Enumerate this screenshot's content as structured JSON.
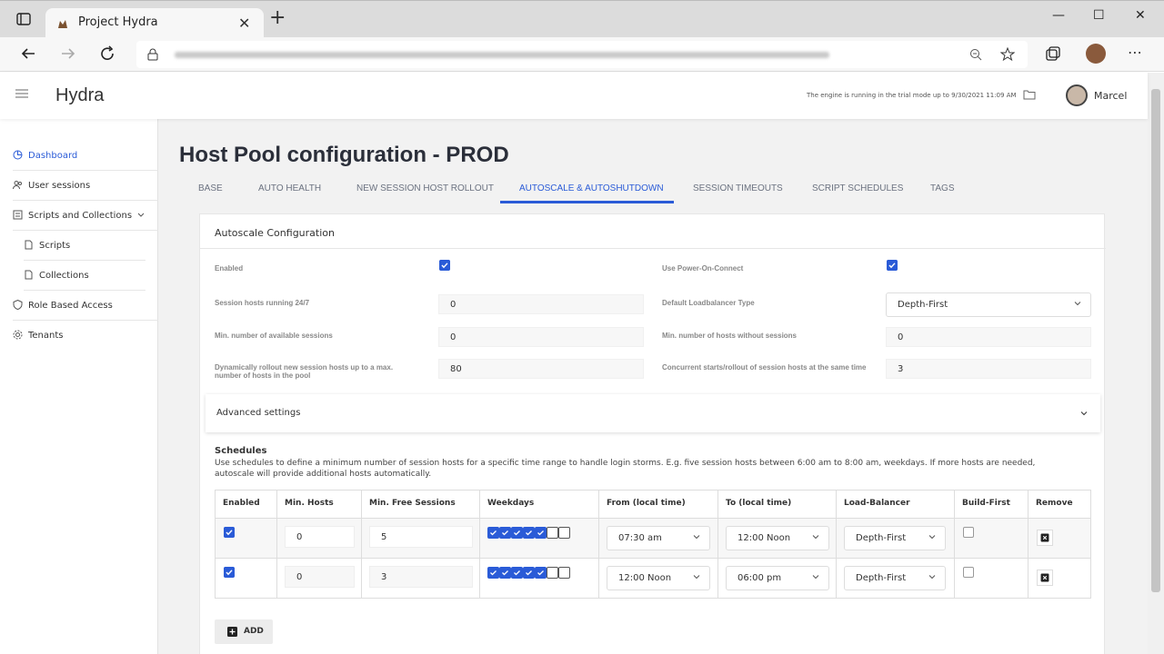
{
  "browser": {
    "tab_title": "Project Hydra",
    "tab_close": "✕",
    "new_tab": "+",
    "minimize": "—",
    "maximize": "☐",
    "close": "✕"
  },
  "header": {
    "app_name": "Hydra",
    "trial_notice": "The engine is running in the trial mode up to 9/30/2021 11:09 AM",
    "user_name": "Marcel"
  },
  "sidebar": {
    "items": [
      {
        "label": "Dashboard",
        "icon": "dashboard-icon"
      },
      {
        "label": "User sessions",
        "icon": "users-icon"
      },
      {
        "label": "Scripts and Collections",
        "icon": "scripts-icon"
      },
      {
        "label": "Scripts",
        "icon": "file-icon"
      },
      {
        "label": "Collections",
        "icon": "file-icon"
      },
      {
        "label": "Role Based Access",
        "icon": "shield-icon"
      },
      {
        "label": "Tenants",
        "icon": "gear-icon"
      }
    ]
  },
  "page": {
    "title": "Host Pool configuration - PROD",
    "tabs": [
      "BASE",
      "AUTO HEALTH",
      "NEW SESSION HOST ROLLOUT",
      "AUTOSCALE & AUTOSHUTDOWN",
      "SESSION TIMEOUTS",
      "SCRIPT SCHEDULES",
      "TAGS"
    ],
    "active_tab": "AUTOSCALE & AUTOSHUTDOWN"
  },
  "autoscale": {
    "title": "Autoscale Configuration",
    "enabled_label": "Enabled",
    "enabled": true,
    "power_on_connect_label": "Use Power-On-Connect",
    "power_on_connect": true,
    "session_hosts_247_label": "Session hosts running 24/7",
    "session_hosts_247": "0",
    "lb_type_label": "Default Loadbalancer Type",
    "lb_type": "Depth-First",
    "min_sessions_label": "Min. number of available sessions",
    "min_sessions": "0",
    "min_hosts_no_sessions_label": "Min. number of hosts without sessions",
    "min_hosts_no_sessions": "0",
    "rollout_max_label": "Dynamically rollout new session hosts up to a max. number of hosts in the pool",
    "rollout_max": "80",
    "concurrent_label": "Concurrent starts/rollout of session hosts at the same time",
    "concurrent": "3",
    "advanced_label": "Advanced settings"
  },
  "schedules": {
    "title": "Schedules",
    "description": "Use schedules to define a minimum number of session hosts for a specific time range to handle login storms. E.g. five session hosts between 6:00 am to 8:00 am, weekdays. If more hosts are needed, autoscale will provide additional hosts automatically.",
    "columns": [
      "Enabled",
      "Min. Hosts",
      "Min. Free Sessions",
      "Weekdays",
      "From (local time)",
      "To (local time)",
      "Load-Balancer",
      "Build-First",
      "Remove"
    ],
    "rows": [
      {
        "enabled": true,
        "min_hosts": "0",
        "min_free": "5",
        "weekdays": [
          true,
          true,
          true,
          true,
          true,
          false,
          false
        ],
        "from": "07:30 am",
        "to": "12:00 Noon",
        "lb": "Depth-First",
        "build_first": false
      },
      {
        "enabled": true,
        "min_hosts": "0",
        "min_free": "3",
        "weekdays": [
          true,
          true,
          true,
          true,
          true,
          false,
          false
        ],
        "from": "12:00 Noon",
        "to": "06:00 pm",
        "lb": "Depth-First",
        "build_first": false
      }
    ],
    "add_label": "ADD"
  },
  "colors": {
    "accent": "#2a5bd7"
  }
}
